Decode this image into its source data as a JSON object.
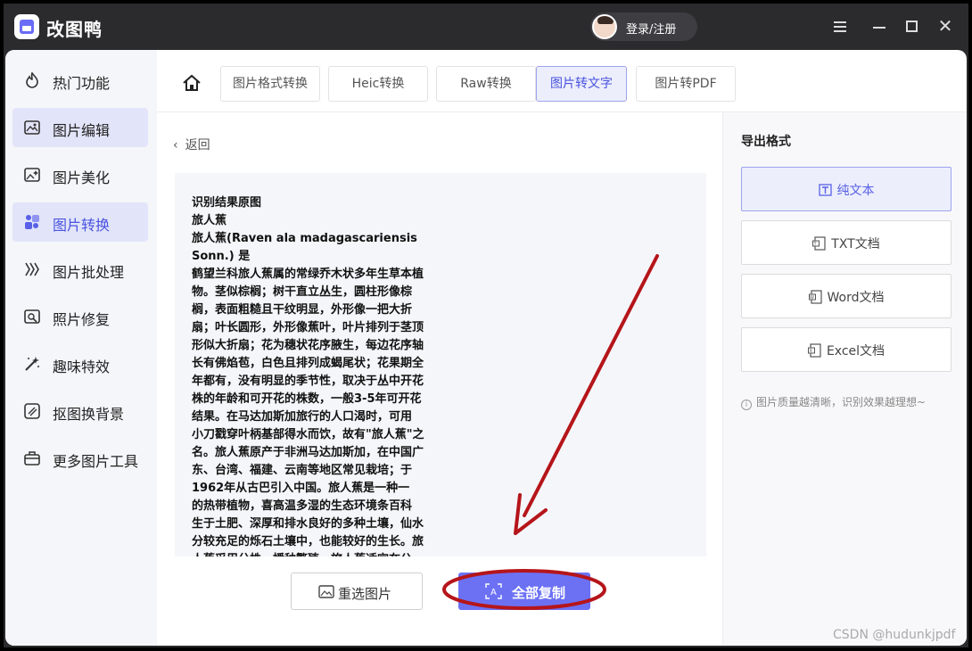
{
  "app": {
    "title": "改图鸭",
    "login_label": "登录/注册",
    "accent_color": "#6c71f4"
  },
  "sidebar": {
    "items": [
      {
        "label": "热门功能",
        "icon": "fire-icon",
        "active": false
      },
      {
        "label": "图片编辑",
        "icon": "image-edit-icon",
        "active": true
      },
      {
        "label": "图片美化",
        "icon": "image-beautify-icon",
        "active": false
      },
      {
        "label": "图片转换",
        "icon": "convert-icon",
        "active": true
      },
      {
        "label": "图片批处理",
        "icon": "batch-icon",
        "active": false
      },
      {
        "label": "照片修复",
        "icon": "photo-repair-icon",
        "active": false
      },
      {
        "label": "趣味特效",
        "icon": "magic-wand-icon",
        "active": false
      },
      {
        "label": "抠图换背景",
        "icon": "cutout-icon",
        "active": false
      },
      {
        "label": "更多图片工具",
        "icon": "toolbox-icon",
        "active": false
      }
    ]
  },
  "tabs": [
    {
      "label": "图片格式转换",
      "active": false
    },
    {
      "label": "Heic转换",
      "active": false
    },
    {
      "label": "Raw转换",
      "active": false
    },
    {
      "label": "图片转文字",
      "active": true
    },
    {
      "label": "图片转PDF",
      "active": false
    }
  ],
  "main": {
    "back_label": "返回",
    "ocr_text": "识别结果原图\n旅人蕉\n旅人蕉(Raven ala madagascariensis Sonn.) 是\n鹤望兰科旅人蕉属的常绿乔木状多年生草本植\n物。茎似棕榈；树干直立丛生，圆柱形像棕\n榈，表面粗糙且干纹明显，外形像一把大折\n扇；叶长圆形，外形像蕉叶，叶片排列于茎顶\n形似大折扇；花为穗状花序腋生，每边花序轴\n长有佛焰苞，白色且排列成蝎尾状；花果期全\n年都有，没有明显的季节性，取决于丛中开花\n株的年龄和可开花的株数，一般3-5年可开花\n结果。在马达加斯加旅行的人口渴时，可用\n小刀戳穿叶柄基部得水而饮，故有\"旅人蕉\"之\n名。旅人蕉原产于非洲马达加斯加，在中国广\n东、台湾、福建、云南等地区常见栽培；于\n1962年从古巴引入中国。旅人蕉是一种一\n的热带植物，喜高温多湿的生态环境条百科\n生于土肥、深厚和排水良好的多种土壤，仙水\n分较充足的烁石土壤中，也能较好的生长。旅\n人蕉采用分株、播种繁殖，旅人蕉适宜在公",
    "reselect_label": "重选图片",
    "copy_all_label": "全部复制"
  },
  "export": {
    "title": "导出格式",
    "formats": [
      {
        "label": "纯文本",
        "icon": "text-icon",
        "active": true
      },
      {
        "label": "TXT文档",
        "icon": "txt-file-icon",
        "active": false
      },
      {
        "label": "Word文档",
        "icon": "word-file-icon",
        "active": false
      },
      {
        "label": "Excel文档",
        "icon": "excel-file-icon",
        "active": false
      }
    ],
    "hint": "图片质量越清晰，识别效果越理想~"
  },
  "watermark": "CSDN @hudunkjpdf"
}
